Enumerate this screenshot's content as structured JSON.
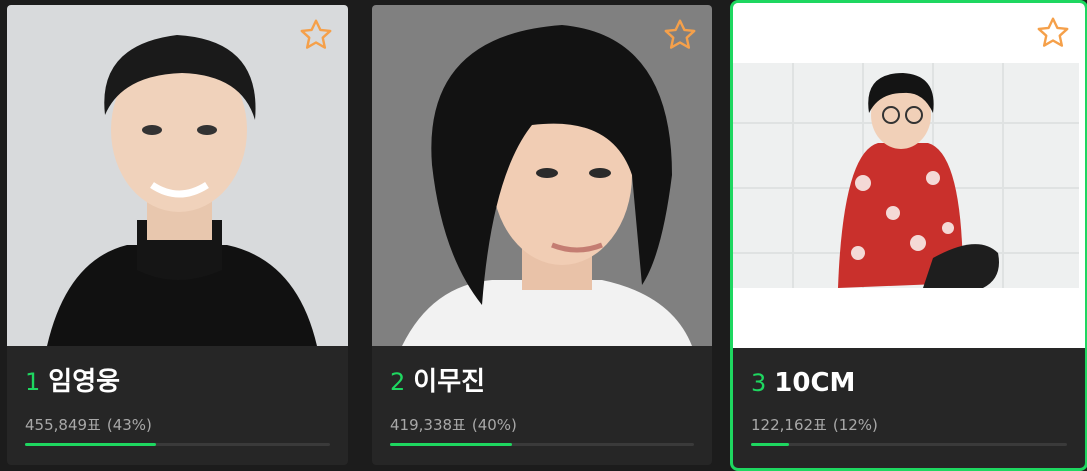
{
  "accent_color": "#1ed760",
  "star_color": "#f5a04a",
  "cards": [
    {
      "rank": "1",
      "name": "임영웅",
      "votes": "455,849표",
      "percent": "(43%)",
      "fraction": 0.43,
      "favorite_icon": "star-outline-icon"
    },
    {
      "rank": "2",
      "name": "이무진",
      "votes": "419,338표",
      "percent": "(40%)",
      "fraction": 0.4,
      "favorite_icon": "star-outline-icon"
    },
    {
      "rank": "3",
      "name": "10CM",
      "votes": "122,162표",
      "percent": "(12%)",
      "fraction": 0.12,
      "favorite_icon": "star-outline-icon",
      "selected": true
    }
  ]
}
